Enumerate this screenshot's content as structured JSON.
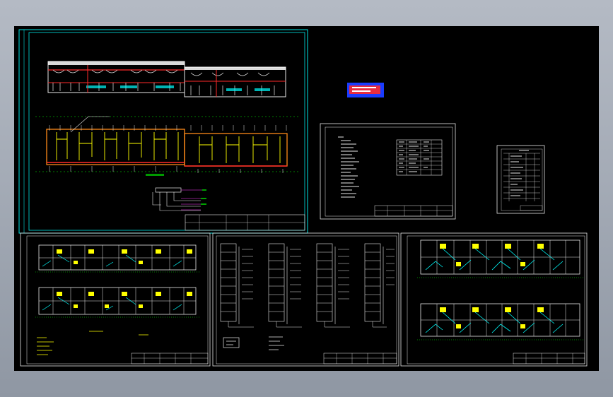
{
  "app": {
    "background_color": "#a8aeb8",
    "viewport_color": "#000000"
  },
  "colors": {
    "sheet_border": "#00e5e5",
    "line_white": "#e8e8e8",
    "accent_red": "#ff2a2a",
    "accent_yellow": "#ffff00",
    "accent_green": "#00ff00",
    "accent_cyan": "#00ffff",
    "accent_blue": "#1a3cff",
    "accent_magenta": "#ff40ff"
  },
  "sheets": [
    {
      "id": "sheet-elevation-plan",
      "role": "electrical layout with elevation and floor plan"
    },
    {
      "id": "sheet-notes",
      "role": "design notes and legend table"
    },
    {
      "id": "sheet-schedule",
      "role": "material schedule table"
    },
    {
      "id": "sheet-floor-plans-left",
      "role": "unit floor plans with lighting"
    },
    {
      "id": "sheet-riser-diagrams",
      "role": "distribution riser diagrams"
    },
    {
      "id": "sheet-floor-plans-right",
      "role": "unit floor plans with wiring"
    }
  ],
  "icons": [
    "stamp-icon"
  ]
}
